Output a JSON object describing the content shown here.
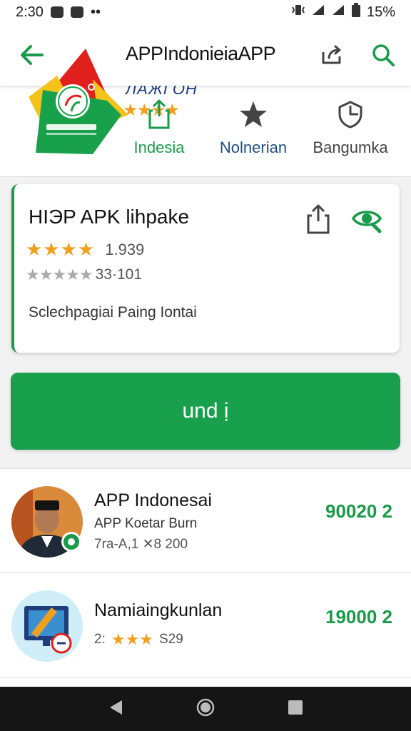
{
  "status_bar": {
    "time": "2:30",
    "battery": "15%"
  },
  "app_bar": {
    "title": "APPIndonieiaAPP"
  },
  "header": {
    "subtitle": "ЛAЖГOH"
  },
  "tabs": [
    {
      "label": "Indesia"
    },
    {
      "label": "Nolnerian"
    },
    {
      "label": "Bangumka"
    }
  ],
  "card": {
    "title": "HIЭP APK lihpake",
    "rating_value": "1.939",
    "rating_count": "33·101",
    "description": "Sclechpagiai Paing Iontai"
  },
  "cta": {
    "label": "und ị"
  },
  "list": {
    "items": [
      {
        "name": "APP Indonesai",
        "subtitle": "APP Koetar Burn",
        "meta": "7ra-A,1 ✕8 200",
        "price": "90020 2"
      },
      {
        "name": "Namiaingkunlan",
        "meta_prefix": "2:",
        "meta_suffix": "S29",
        "price": "19000 2"
      }
    ]
  },
  "colors": {
    "accent": "#18a04c",
    "star": "#f0a021",
    "navy": "#1f3d7a"
  }
}
